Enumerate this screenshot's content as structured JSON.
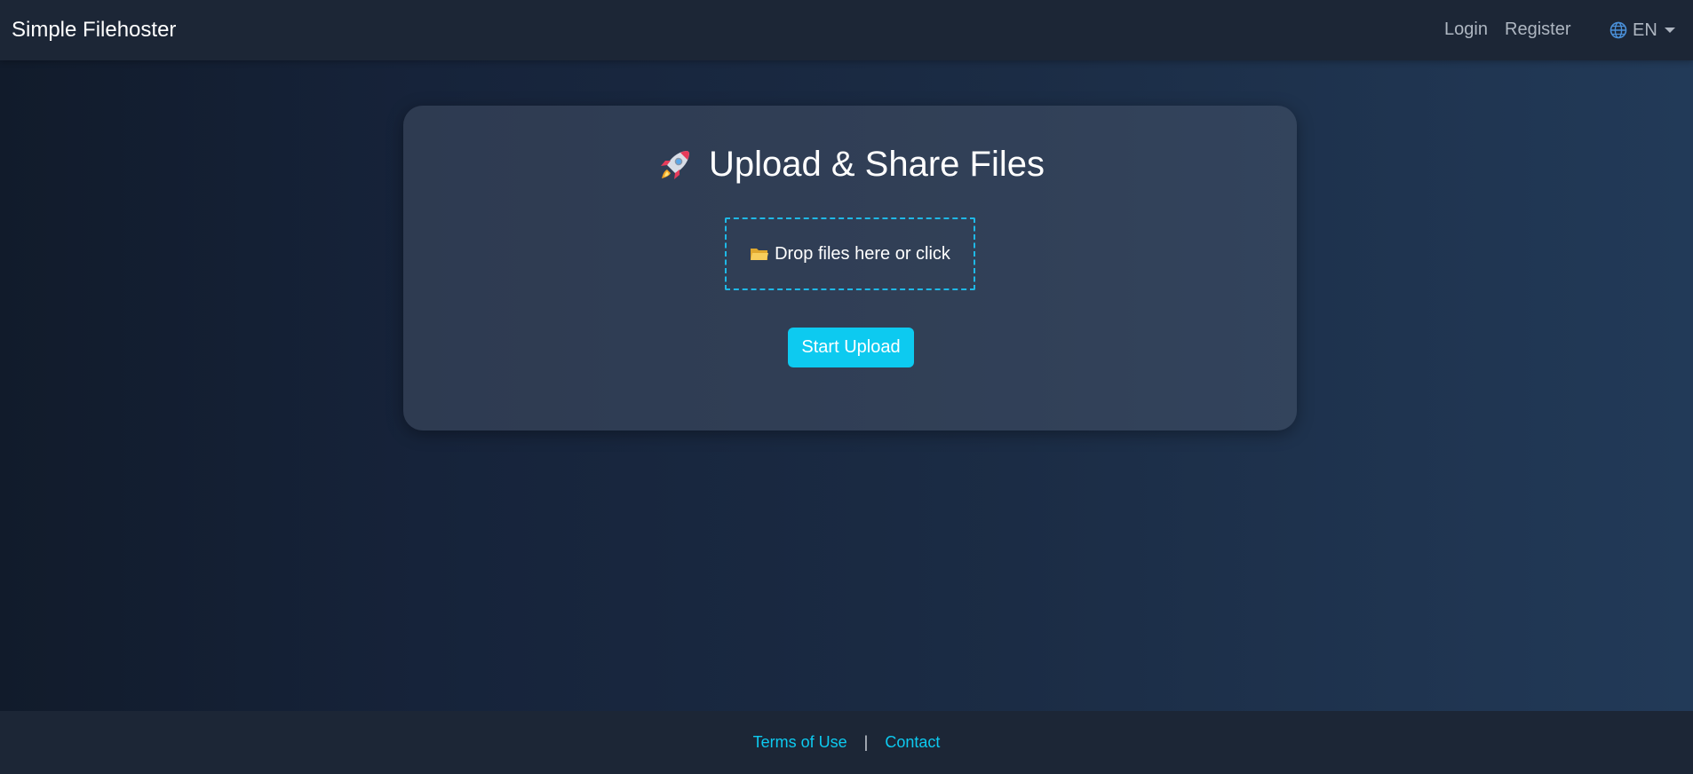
{
  "navbar": {
    "brand": "Simple Filehoster",
    "login_label": "Login",
    "register_label": "Register",
    "language": {
      "icon": "globe-icon",
      "selected": "EN"
    }
  },
  "upload_card": {
    "title_icon": "rocket-icon",
    "title": "Upload & Share Files",
    "dropzone": {
      "icon": "folder-icon",
      "label": "Drop files here or click"
    },
    "upload_button_label": "Start Upload"
  },
  "footer": {
    "terms_label": "Terms of Use",
    "separator": "|",
    "contact_label": "Contact"
  },
  "colors": {
    "accent": "#0dcaf0",
    "navbar_bg": "#1c2636",
    "page_bg_dark": "#111b2b",
    "page_bg_light": "#223a58"
  }
}
